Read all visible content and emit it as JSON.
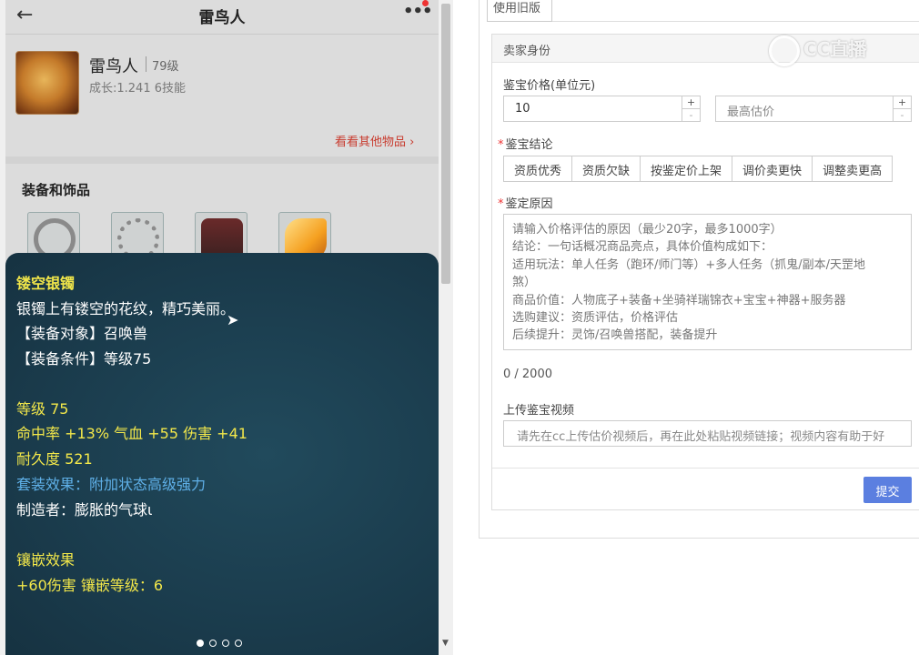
{
  "mobile": {
    "title": "雷鸟人",
    "pet": {
      "name": "雷鸟人",
      "level": "79级",
      "growth": "成长:1.241 6技能"
    },
    "other_items_link": "看看其他物品",
    "equip_section_title": "装备和饰品"
  },
  "tooltip": {
    "item_name": "镂空银镯",
    "description": "银镯上有镂空的花纹，精巧美丽。",
    "target": "【装备对象】召唤兽",
    "requirement": "【装备条件】等级75",
    "level": "等级 75",
    "stats": "命中率 +13% 气血 +55 伤害 +41",
    "durability": "耐久度 521",
    "set_effect": "套装效果：附加状态高级强力",
    "maker": "制造者：膨胀的气球ι",
    "inlay_title": "镶嵌效果",
    "inlay_value": "+60伤害 镶嵌等级：6",
    "page_count": 4,
    "active_page": 1
  },
  "form": {
    "tab_label": "使用旧版",
    "section_title": "卖家身份",
    "price_label": "鉴宝价格(单位元)",
    "price_value": "10",
    "max_estimate_placeholder": "最高估价",
    "stepper_plus": "+",
    "stepper_minus": "-",
    "conclusion_label": "鉴宝结论",
    "conclusions": [
      "资质优秀",
      "资质欠缺",
      "按鉴定价上架",
      "调价卖更快",
      "调整卖更高"
    ],
    "reason_label": "鉴定原因",
    "reason_placeholder_lines": [
      "请输入价格评估的原因（最少20字，最多1000字）",
      "  结论：一句话概况商品亮点，具体价值构成如下：",
      "  适用玩法：单人任务（跑环/师门等）+多人任务（抓鬼/副本/天罡地",
      "煞）",
      "  商品价值：人物底子+装备+坐骑祥瑞锦衣+宝宝+神器+服务器",
      "  选购建议：资质评估，价格评估",
      "  后续提升：灵饰/召唤兽搭配，装备提升"
    ],
    "char_counter": "0 / 2000",
    "video_label": "上传鉴宝视频",
    "video_placeholder": "请先在cc上传估价视频后，再在此处粘贴视频链接；视频内容有助于好",
    "submit_label": "提交"
  },
  "watermark": "CC直播"
}
